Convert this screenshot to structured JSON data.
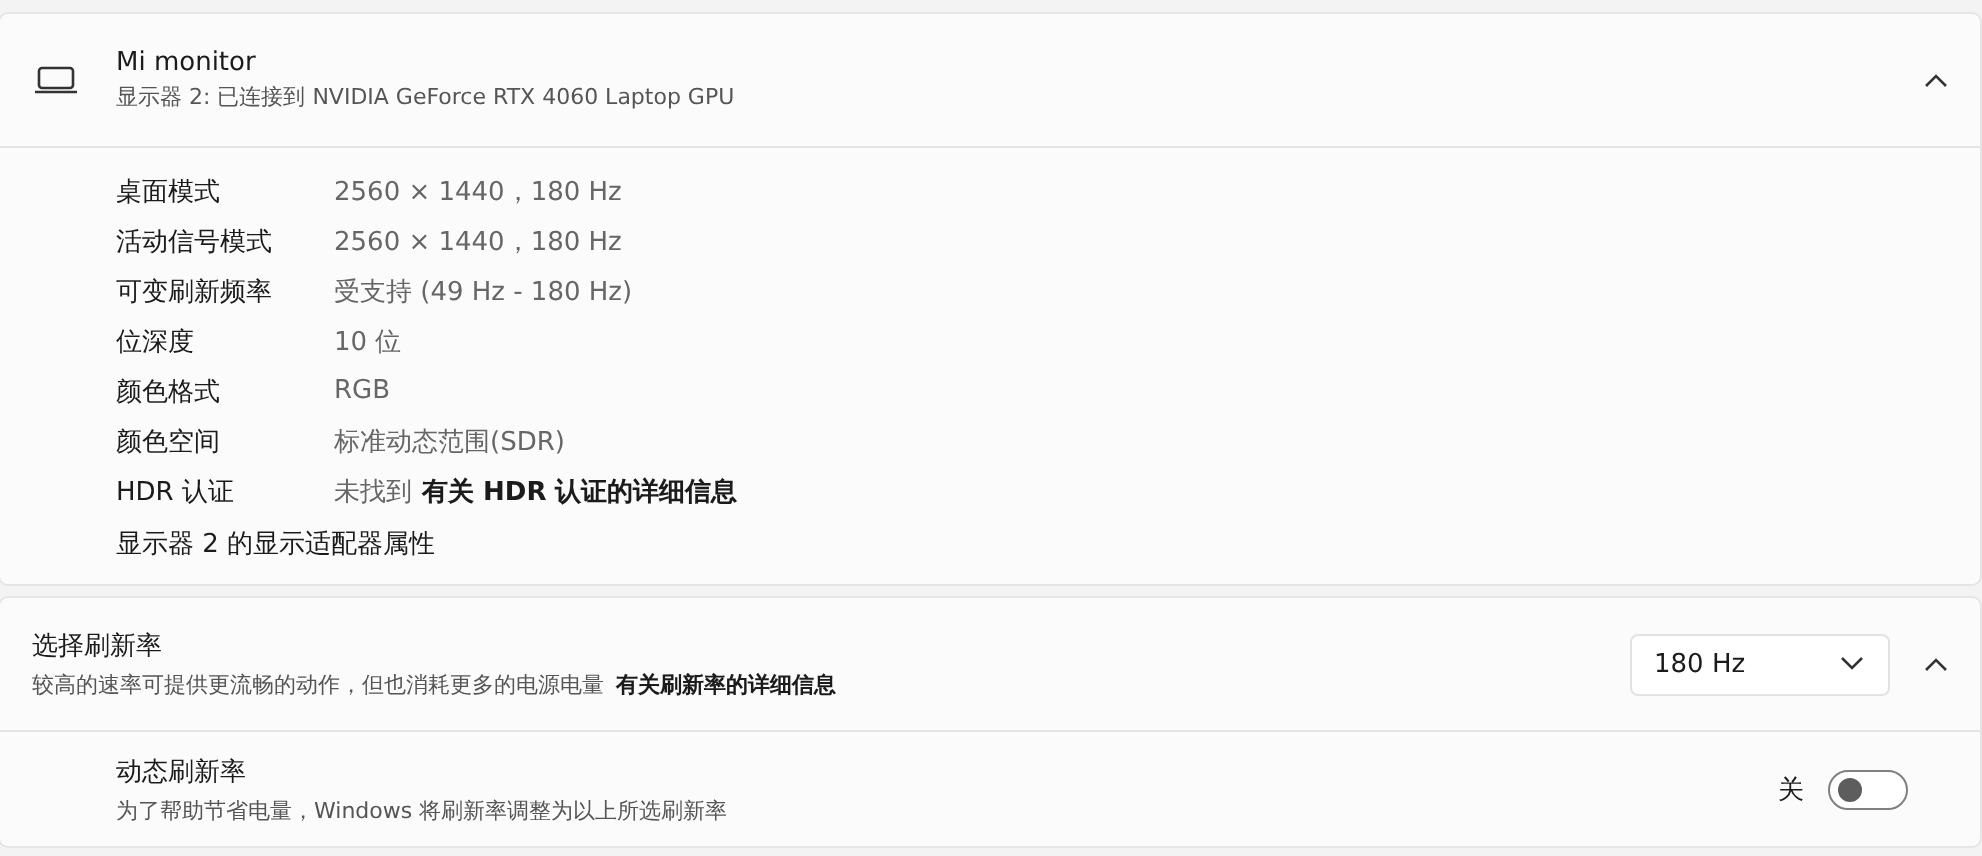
{
  "display": {
    "title": "Mi monitor",
    "subtitle": "显示器 2: 已连接到 NVIDIA GeForce RTX 4060 Laptop GPU",
    "expanded": true,
    "details": [
      {
        "label": "桌面模式",
        "value": "2560 × 1440，180 Hz"
      },
      {
        "label": "活动信号模式",
        "value": "2560 × 1440，180 Hz"
      },
      {
        "label": "可变刷新频率",
        "value": "受支持 (49 Hz - 180 Hz)"
      },
      {
        "label": "位深度",
        "value": "10 位"
      },
      {
        "label": "颜色格式",
        "value": "RGB"
      },
      {
        "label": "颜色空间",
        "value": "标准动态范围(SDR)"
      },
      {
        "label": "HDR 认证",
        "value": "未找到",
        "link": "有关 HDR 认证的详细信息"
      }
    ],
    "adapter_link": "显示器 2 的显示适配器属性"
  },
  "refresh_rate": {
    "title": "选择刷新率",
    "description": "较高的速率可提供更流畅的动作，但也消耗更多的电源电量",
    "link": "有关刷新率的详细信息",
    "dropdown": {
      "value": "180 Hz"
    },
    "expanded": true
  },
  "dynamic_refresh": {
    "title": "动态刷新率",
    "description": "为了帮助节省电量，Windows 将刷新率调整为以上所选刷新率",
    "state_label": "关",
    "on": false
  }
}
